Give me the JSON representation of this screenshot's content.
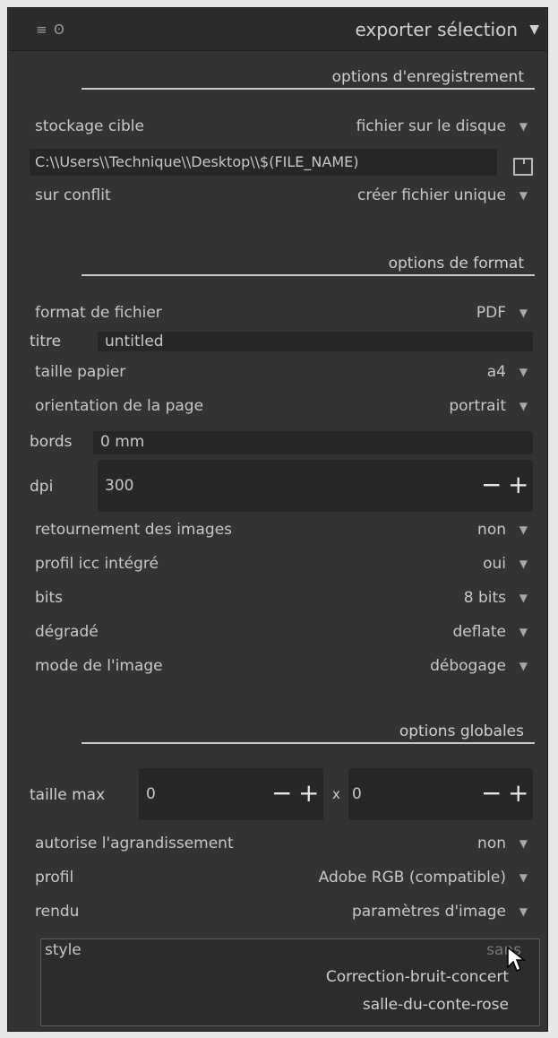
{
  "header": {
    "menu_icon": "≡",
    "power_icon": "ʘ",
    "title": "exporter sélection",
    "collapse_icon": "▼"
  },
  "save_options": {
    "section_title": "options d'enregistrement",
    "target_storage": {
      "label": "stockage cible",
      "value": "fichier sur le disque"
    },
    "path": "C:\\\\Users\\\\Technique\\\\Desktop\\\\$(FILE_NAME)",
    "on_conflict": {
      "label": "sur conflit",
      "value": "créer fichier unique"
    }
  },
  "format_options": {
    "section_title": "options de format",
    "file_format": {
      "label": "format de fichier",
      "value": "PDF"
    },
    "title": {
      "label": "titre",
      "placeholder": "untitled"
    },
    "paper_size": {
      "label": "taille papier",
      "value": "a4"
    },
    "orientation": {
      "label": "orientation de la page",
      "value": "portrait"
    },
    "border": {
      "label": "bords",
      "value": "0 mm"
    },
    "dpi": {
      "label": "dpi",
      "value": "300"
    },
    "rotate": {
      "label": "retournement des images",
      "value": "non"
    },
    "icc": {
      "label": "profil icc intégré",
      "value": "oui"
    },
    "bits": {
      "label": "bits",
      "value": "8 bits"
    },
    "compression": {
      "label": "dégradé",
      "value": "deflate"
    },
    "image_mode": {
      "label": "mode de l'image",
      "value": "débogage"
    }
  },
  "global_options": {
    "section_title": "options globales",
    "max_size": {
      "label": "taille max",
      "width": "0",
      "height": "0",
      "separator": "x"
    },
    "upscale": {
      "label": "autorise l'agrandissement",
      "value": "non"
    },
    "profile": {
      "label": "profil",
      "value": "Adobe RGB (compatible)"
    },
    "intent": {
      "label": "rendu",
      "value": "paramètres d'image"
    },
    "style": {
      "label": "style",
      "items": [
        "sans",
        "Correction-bruit-concert",
        "salle-du-conte-rose"
      ]
    }
  },
  "glyphs": {
    "dropdown": "▼",
    "minus": "−",
    "plus": "+"
  },
  "colors": {
    "panel": "#333333",
    "field": "#272727",
    "text": "#c8c8c8"
  }
}
